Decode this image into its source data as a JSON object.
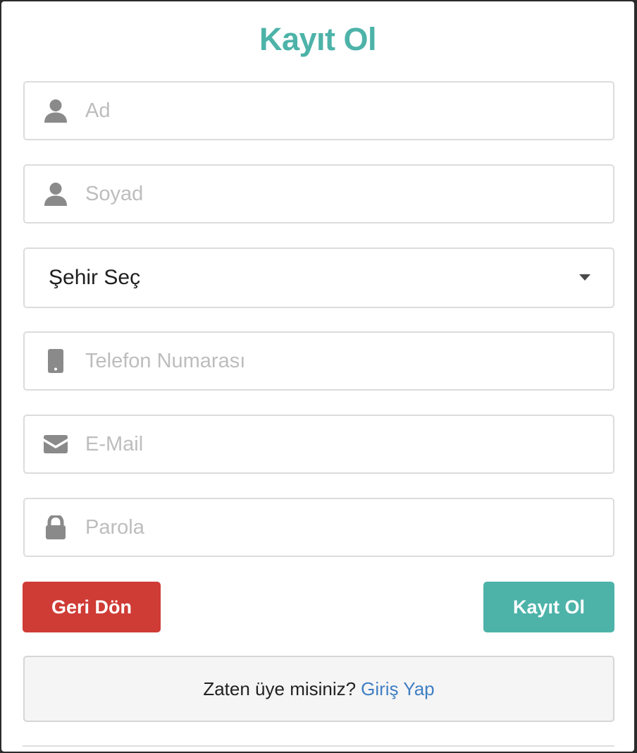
{
  "form": {
    "title": "Kayıt Ol",
    "fields": {
      "first_name": {
        "placeholder": "Ad",
        "icon": "user-icon"
      },
      "last_name": {
        "placeholder": "Soyad",
        "icon": "user-icon"
      },
      "city": {
        "selected": "Şehir Seç",
        "icon": "caret-down-icon"
      },
      "phone": {
        "placeholder": "Telefon Numarası",
        "icon": "mobile-phone-icon"
      },
      "email": {
        "placeholder": "E-Mail",
        "icon": "envelope-icon"
      },
      "password": {
        "placeholder": "Parola",
        "icon": "lock-icon"
      }
    },
    "buttons": {
      "back_label": "Geri Dön",
      "register_label": "Kayıt Ol"
    },
    "footer": {
      "prompt": "Zaten üye misiniz?",
      "link": "Giriş Yap"
    }
  },
  "colors": {
    "accent": "#4db3a9",
    "danger": "#cf3b35",
    "link": "#3f7fc4",
    "icon": "#8a8a8a",
    "placeholder": "#bdbdbd"
  }
}
